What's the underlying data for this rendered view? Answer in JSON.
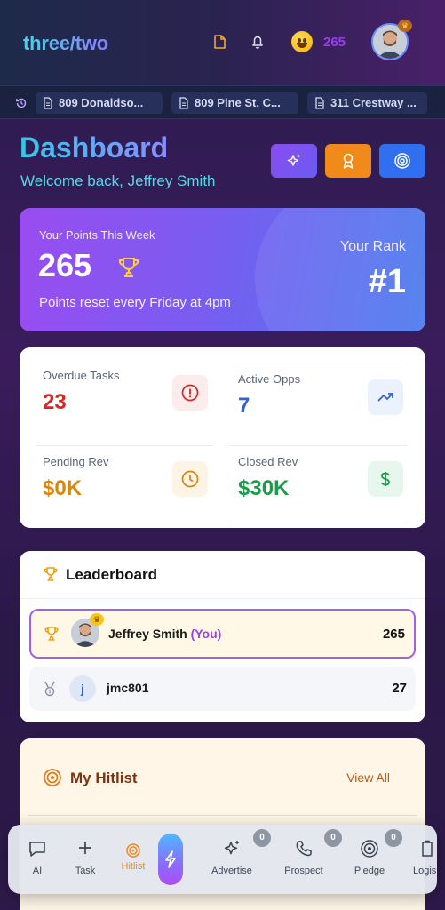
{
  "app": {
    "logo": "three/two"
  },
  "header": {
    "points": "265",
    "notes_icon": "note-icon",
    "bell_icon": "bell-icon"
  },
  "recent": {
    "items": [
      "809 Donaldso...",
      "809 Pine St, C...",
      "311 Crestway ..."
    ]
  },
  "dashboard": {
    "title": "Dashboard",
    "welcome": "Welcome back, Jeffrey Smith"
  },
  "points_card": {
    "label": "Your Points This Week",
    "points": "265",
    "reset_note": "Points reset every Friday at 4pm",
    "rank_label": "Your Rank",
    "rank": "#1"
  },
  "stats": [
    {
      "label": "Overdue Tasks",
      "value": "23",
      "color": "#d62828"
    },
    {
      "label": "Active Opps",
      "value": "7",
      "color": "#2f62d8"
    },
    {
      "label": "Pending Rev",
      "value": "$0K",
      "color": "#d9860f"
    },
    {
      "label": "Closed Rev",
      "value": "$30K",
      "color": "#1e9a4a"
    }
  ],
  "leaderboard": {
    "title": "Leaderboard",
    "rows": [
      {
        "name": "Jeffrey Smith",
        "you_tag": "(You)",
        "score": "265"
      },
      {
        "name": "jmc801",
        "initial": "j",
        "score": "27"
      }
    ]
  },
  "hitlist": {
    "title": "My Hitlist",
    "view_all": "View All"
  },
  "nav": {
    "items": [
      {
        "label": "AI"
      },
      {
        "label": "Task"
      },
      {
        "label": "Hitlist"
      },
      {
        "label": "Advertise",
        "badge": "0"
      },
      {
        "label": "Prospect",
        "badge": "0"
      },
      {
        "label": "Pledge",
        "badge": "0"
      },
      {
        "label": "Logis"
      }
    ]
  },
  "colors": {
    "accent": "#9b3cf0",
    "points_gradient_start": "#9a4cf0",
    "points_gradient_end": "#4a7aee"
  }
}
